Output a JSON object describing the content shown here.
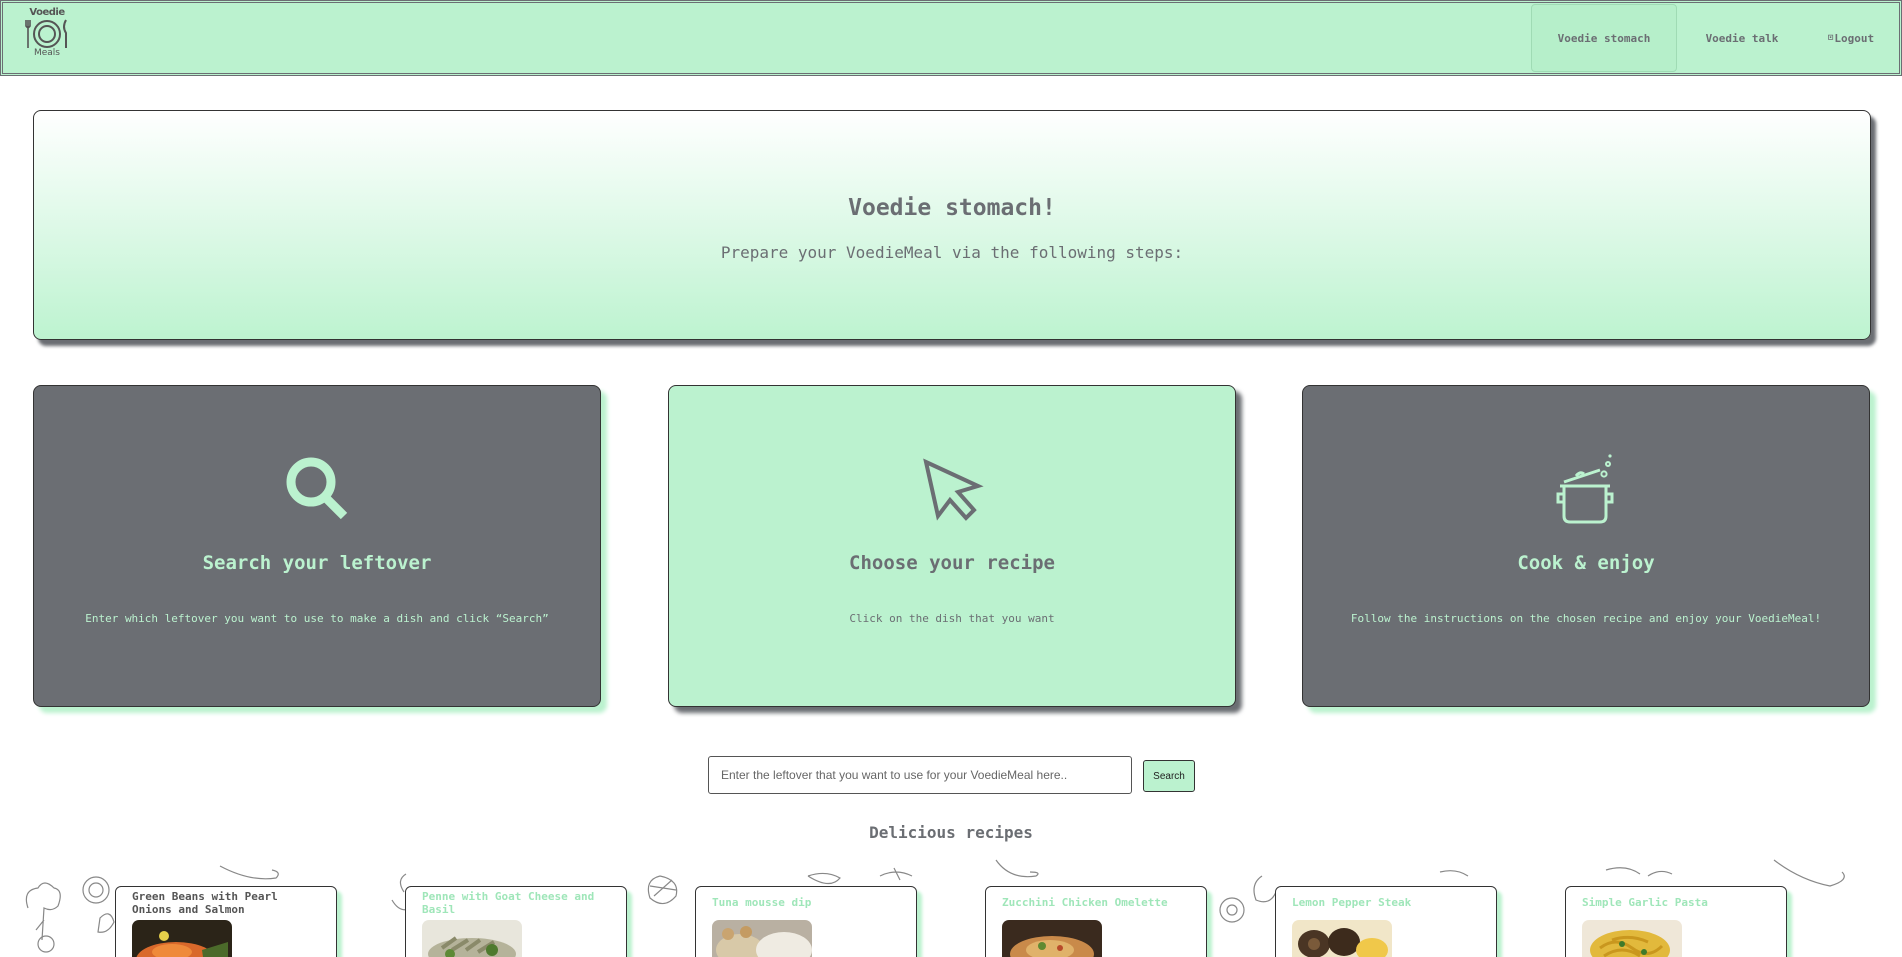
{
  "logo": {
    "line1": "Voedie",
    "line2": "Meals"
  },
  "nav": {
    "items": [
      {
        "label": "Voedie stomach",
        "active": true
      },
      {
        "label": "Voedie talk",
        "active": false
      }
    ],
    "logout_glyph": "⊡",
    "logout_label": "Logout"
  },
  "hero": {
    "title": "Voedie stomach!",
    "subtitle": "Prepare your VoedieMeal via the following steps:"
  },
  "steps": [
    {
      "icon": "magnifier-icon",
      "title": "Search your leftover",
      "description": "Enter which leftover you want to use to make a dish and click “Search”"
    },
    {
      "icon": "cursor-icon",
      "title": "Choose your recipe",
      "description": "Click on the dish that you want"
    },
    {
      "icon": "cooking-pot-icon",
      "title": "Cook & enjoy",
      "description": "Follow the instructions on the chosen recipe and enjoy your VoedieMeal!"
    }
  ],
  "search": {
    "placeholder": "Enter the leftover that you want to use for your VoedieMeal here..",
    "button_label": "Search"
  },
  "recipes_heading": "Delicious recipes",
  "recipes": [
    {
      "title": "Green Beans with Pearl Onions and Salmon"
    },
    {
      "title": "Penne with Goat Cheese and Basil"
    },
    {
      "title": "Tuna mousse dip"
    },
    {
      "title": "Zucchini Chicken Omelette"
    },
    {
      "title": "Lemon Pepper Steak"
    },
    {
      "title": "Simple Garlic Pasta"
    }
  ],
  "colors": {
    "mint": "#bbf2cf",
    "slate": "#6b6e73"
  }
}
